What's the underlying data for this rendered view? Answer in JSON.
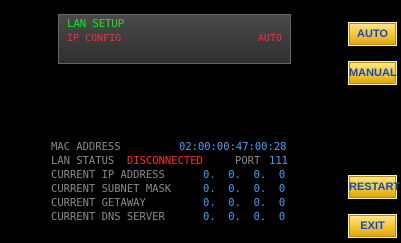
{
  "colors": {
    "background": "#000000",
    "panel_title": "#14e81a",
    "panel_row": "#e4383d",
    "label": "#8a8a8a",
    "value": "#3fa1ff",
    "status_bad": "#ff2a2a",
    "button_text": "#1446c9"
  },
  "lan_setup": {
    "title": "LAN SETUP",
    "ip_label": "IP CONFIG",
    "ip_value": "AUTO"
  },
  "buttons": {
    "auto": "AUTO",
    "manual": "MANUAL",
    "restart": "RESTART",
    "exit": "EXIT"
  },
  "info": {
    "mac_label": "MAC ADDRESS",
    "mac_value": "02:00:00:47:00:28",
    "lan_status_label": "LAN STATUS",
    "lan_status_value": "DISCONNECTED",
    "port_label": "PORT",
    "port_value": "111",
    "ip_label": "CURRENT IP ADDRESS",
    "ip_value": "0.  0.  0.  0",
    "subnet_label": "CURRENT SUBNET MASK",
    "subnet_value": "0.  0.  0.  0",
    "gateway_label": "CURRENT GETAWAY",
    "gateway_value": "0.  0.  0.  0",
    "dns_label": "CURRENT DNS SERVER",
    "dns_value": "0.  0.  0.  0"
  }
}
